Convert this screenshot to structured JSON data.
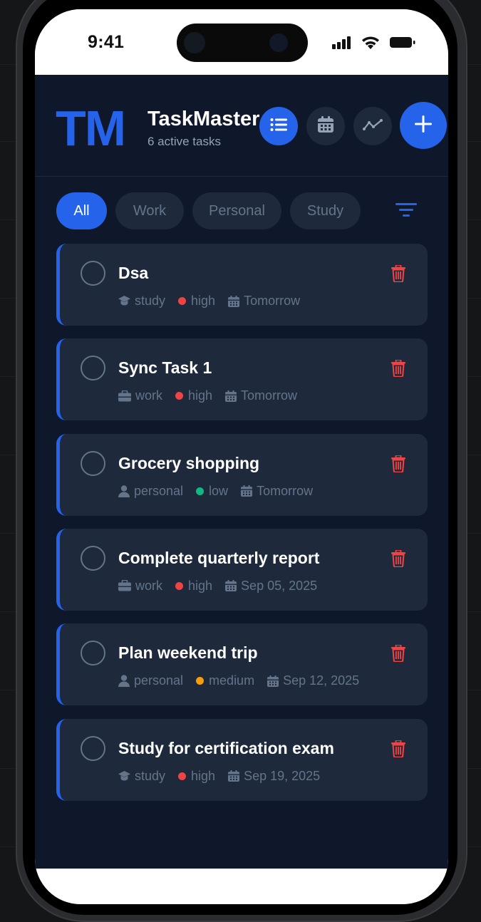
{
  "status_bar": {
    "time": "9:41"
  },
  "header": {
    "logo": "TM",
    "title": "TaskMaster",
    "subtitle": "6 active tasks"
  },
  "filters": [
    "All",
    "Work",
    "Personal",
    "Study"
  ],
  "colors": {
    "accent": "#2563eb",
    "background": "#0f172a",
    "card": "#1e293b",
    "high": "#ef4444",
    "medium": "#f59e0b",
    "low": "#10b981",
    "delete": "#ef4444"
  },
  "tasks": [
    {
      "title": "Dsa",
      "category": "study",
      "category_icon": "graduation-cap-icon",
      "priority": "high",
      "due": "Tomorrow"
    },
    {
      "title": "Sync Task 1",
      "category": "work",
      "category_icon": "briefcase-icon",
      "priority": "high",
      "due": "Tomorrow"
    },
    {
      "title": "Grocery shopping",
      "category": "personal",
      "category_icon": "user-icon",
      "priority": "low",
      "due": "Tomorrow"
    },
    {
      "title": "Complete quarterly report",
      "category": "work",
      "category_icon": "briefcase-icon",
      "priority": "high",
      "due": "Sep 05, 2025"
    },
    {
      "title": "Plan weekend trip",
      "category": "personal",
      "category_icon": "user-icon",
      "priority": "medium",
      "due": "Sep 12, 2025"
    },
    {
      "title": "Study for certification exam",
      "category": "study",
      "category_icon": "graduation-cap-icon",
      "priority": "high",
      "due": "Sep 19, 2025"
    }
  ]
}
